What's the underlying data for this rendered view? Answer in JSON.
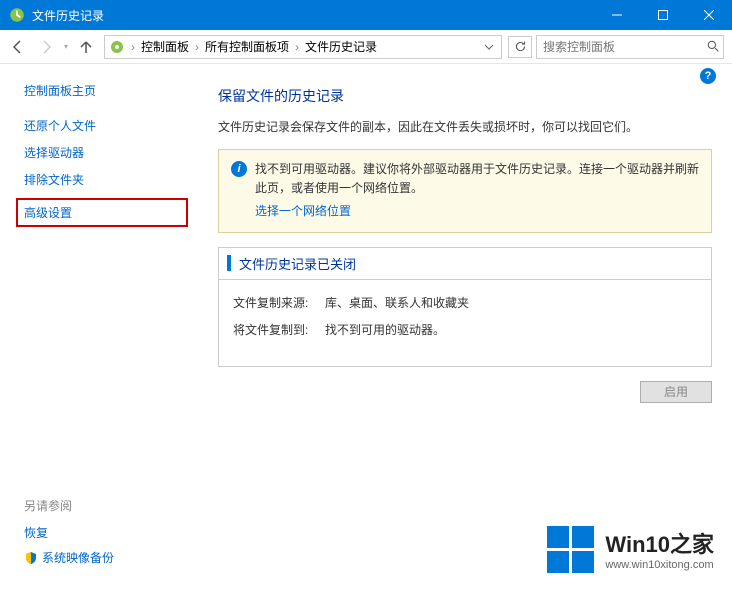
{
  "window": {
    "title": "文件历史记录"
  },
  "breadcrumb": {
    "items": [
      "控制面板",
      "所有控制面板项",
      "文件历史记录"
    ]
  },
  "search": {
    "placeholder": "搜索控制面板"
  },
  "sidebar": {
    "home": "控制面板主页",
    "links": [
      "还原个人文件",
      "选择驱动器",
      "排除文件夹",
      "高级设置"
    ],
    "see_also_header": "另请参阅",
    "see_also": [
      "恢复",
      "系统映像备份"
    ]
  },
  "main": {
    "title": "保留文件的历史记录",
    "subtitle": "文件历史记录会保存文件的副本，因此在文件丢失或损坏时，你可以找回它们。",
    "info_text": "找不到可用驱动器。建议你将外部驱动器用于文件历史记录。连接一个驱动器并刷新此页，或者使用一个网络位置。",
    "info_link": "选择一个网络位置",
    "status_title": "文件历史记录已关闭",
    "copy_from_label": "文件复制来源:",
    "copy_from_value": "库、桌面、联系人和收藏夹",
    "copy_to_label": "将文件复制到:",
    "copy_to_value": "找不到可用的驱动器。",
    "enable_button": "启用"
  },
  "watermark": {
    "title": "Win10之家",
    "url": "www.win10xitong.com"
  }
}
